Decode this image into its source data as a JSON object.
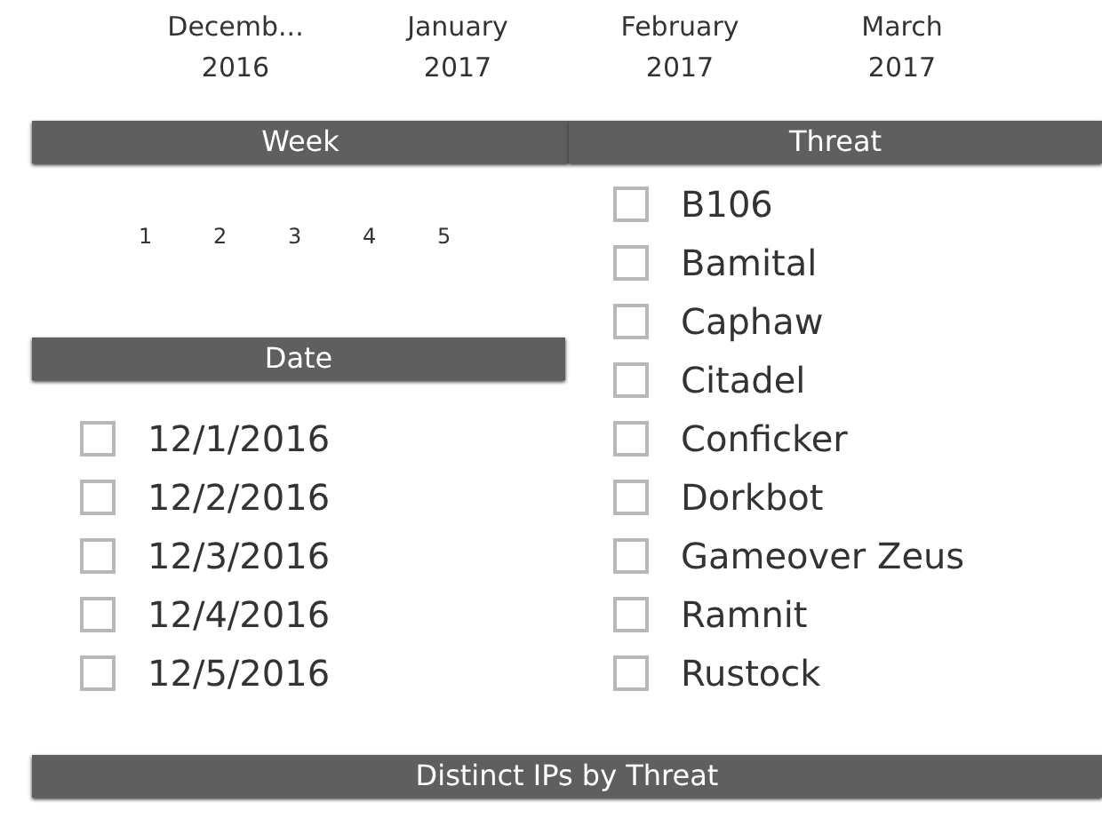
{
  "months": [
    {
      "month": "Decemb...",
      "year": "2016"
    },
    {
      "month": "January",
      "year": "2017"
    },
    {
      "month": "February",
      "year": "2017"
    },
    {
      "month": "March",
      "year": "2017"
    }
  ],
  "week": {
    "title": "Week",
    "values": [
      "1",
      "2",
      "3",
      "4",
      "5"
    ]
  },
  "date": {
    "title": "Date",
    "items": [
      {
        "label": "12/1/2016",
        "checked": false
      },
      {
        "label": "12/2/2016",
        "checked": false
      },
      {
        "label": "12/3/2016",
        "checked": false
      },
      {
        "label": "12/4/2016",
        "checked": false
      },
      {
        "label": "12/5/2016",
        "checked": false
      }
    ]
  },
  "threat": {
    "title": "Threat",
    "items": [
      {
        "label": "B106",
        "checked": false
      },
      {
        "label": "Bamital",
        "checked": false
      },
      {
        "label": "Caphaw",
        "checked": false
      },
      {
        "label": "Citadel",
        "checked": false
      },
      {
        "label": "Conficker",
        "checked": false
      },
      {
        "label": "Dorkbot",
        "checked": false
      },
      {
        "label": "Gameover Zeus",
        "checked": false
      },
      {
        "label": "Ramnit",
        "checked": false
      },
      {
        "label": "Rustock",
        "checked": false
      }
    ]
  },
  "chart": {
    "title": "Distinct IPs by Threat"
  }
}
